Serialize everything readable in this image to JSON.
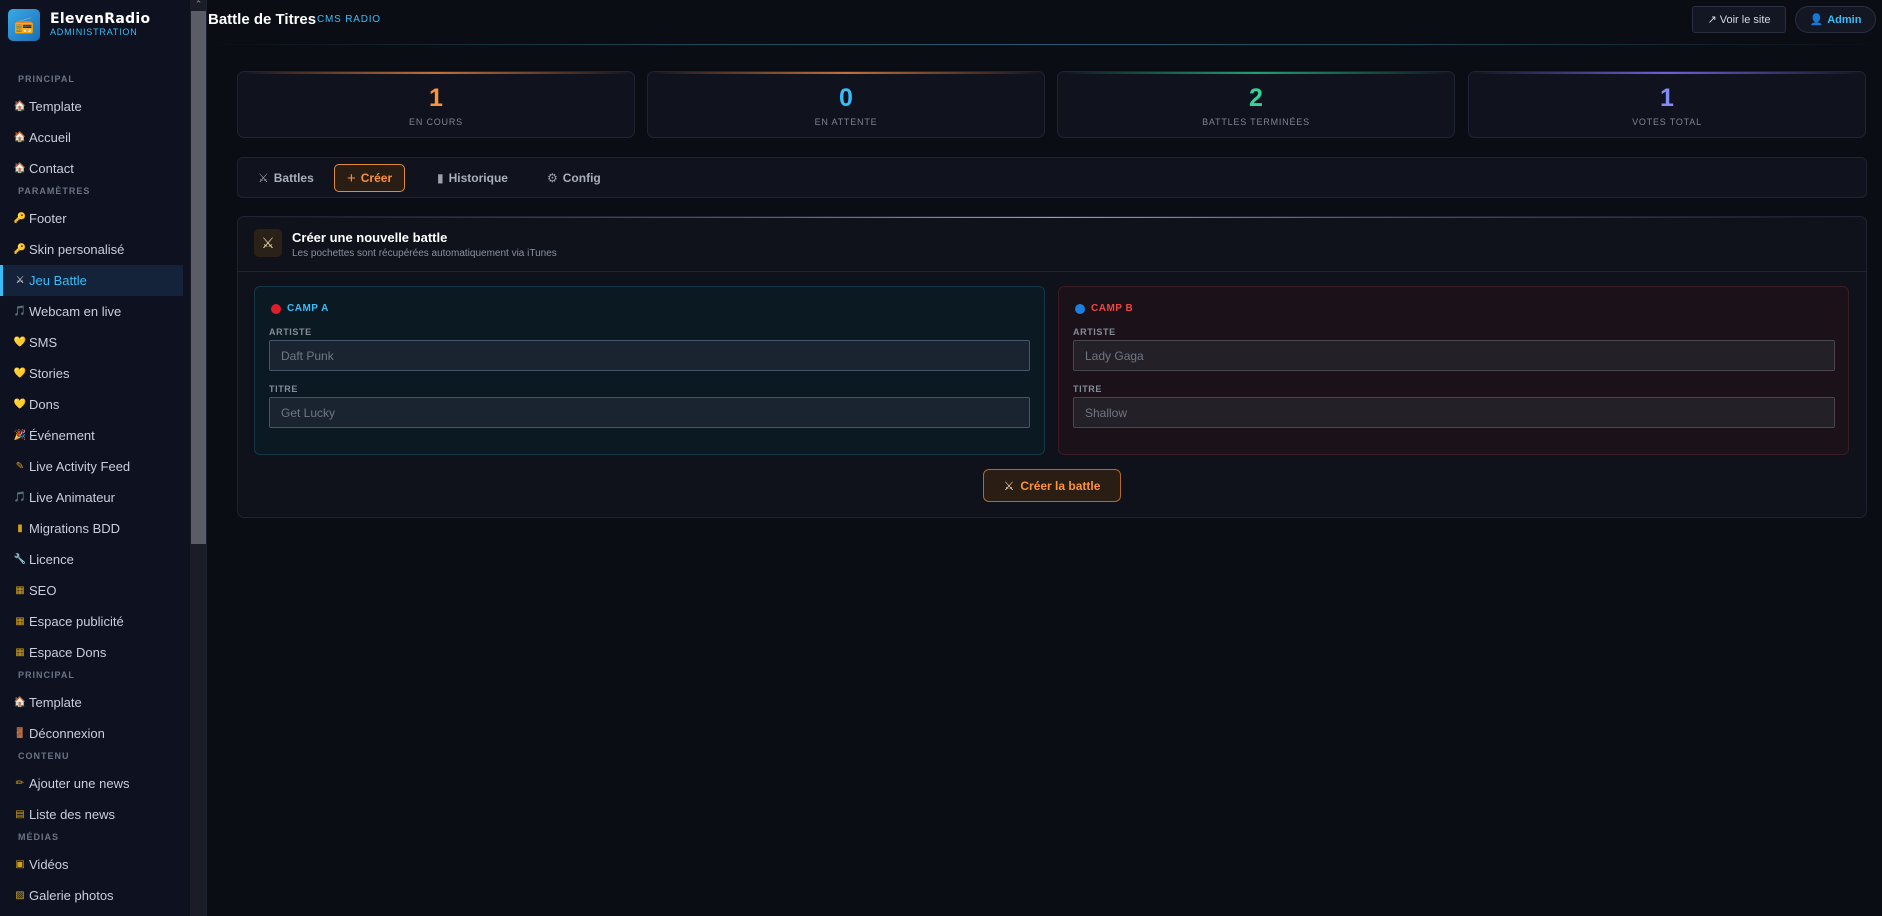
{
  "brand": {
    "logo_glyph": "📻",
    "name": "ElevenRadio",
    "subtitle": "ADMINISTRATION"
  },
  "sidebar": {
    "sections": [
      {
        "title": "PRINCIPAL",
        "items": [
          {
            "icon": "home-icon",
            "glyph": "🏠",
            "label": "Template"
          },
          {
            "icon": "home-icon",
            "glyph": "🏠",
            "label": "Accueil"
          },
          {
            "icon": "home-icon",
            "glyph": "🏠",
            "label": "Contact"
          }
        ]
      },
      {
        "title": "PARAMÈTRES",
        "items": [
          {
            "icon": "key-icon",
            "glyph": "🔑",
            "label": "Footer"
          },
          {
            "icon": "key-icon",
            "glyph": "🔑",
            "label": "Skin personalisé"
          },
          {
            "icon": "swords-icon",
            "glyph": "⚔",
            "label": "Jeu Battle",
            "active": true
          },
          {
            "icon": "music-icon",
            "glyph": "🎵",
            "label": "Webcam en live"
          },
          {
            "icon": "heart-icon",
            "glyph": "💛",
            "label": "SMS"
          },
          {
            "icon": "heart-icon",
            "glyph": "💛",
            "label": "Stories"
          },
          {
            "icon": "heart-icon",
            "glyph": "💛",
            "label": "Dons"
          },
          {
            "icon": "party-icon",
            "glyph": "🎉",
            "label": "Événement"
          },
          {
            "icon": "pen-icon",
            "glyph": "✎",
            "label": "Live Activity Feed"
          },
          {
            "icon": "music-icon",
            "glyph": "🎵",
            "label": "Live Animateur"
          },
          {
            "icon": "database-icon",
            "glyph": "▮",
            "label": "Migrations BDD"
          },
          {
            "icon": "wrench-icon",
            "glyph": "🔧",
            "label": "Licence"
          },
          {
            "icon": "chart-icon",
            "glyph": "▦",
            "label": "SEO"
          },
          {
            "icon": "chart-icon",
            "glyph": "▦",
            "label": "Espace publicité"
          },
          {
            "icon": "chart-icon",
            "glyph": "▦",
            "label": "Espace Dons"
          }
        ]
      },
      {
        "title": "PRINCIPAL",
        "items": [
          {
            "icon": "home-icon",
            "glyph": "🏠",
            "label": "Template"
          },
          {
            "icon": "door-icon",
            "glyph": "🚪",
            "label": "Déconnexion"
          }
        ]
      },
      {
        "title": "CONTENU",
        "items": [
          {
            "icon": "pencil-icon",
            "glyph": "✏",
            "label": "Ajouter une news"
          },
          {
            "icon": "list-icon",
            "glyph": "▤",
            "label": "Liste des news"
          }
        ]
      },
      {
        "title": "MÉDIAS",
        "items": [
          {
            "icon": "film-icon",
            "glyph": "▣",
            "label": "Vidéos"
          },
          {
            "icon": "image-icon",
            "glyph": "▨",
            "label": "Galerie photos"
          }
        ]
      }
    ]
  },
  "topbar": {
    "title": "Battle de Titres",
    "badge": "CMS RADIO",
    "view_site": "↗ Voir le site",
    "admin_label": "Admin",
    "admin_glyph": "👤"
  },
  "stats": [
    {
      "value": "1",
      "label": "EN COURS",
      "color": "#fb923c"
    },
    {
      "value": "0",
      "label": "EN ATTENTE",
      "color": "#38bdf8"
    },
    {
      "value": "2",
      "label": "BATTLES TERMINÉES",
      "color": "#34d399"
    },
    {
      "value": "1",
      "label": "VOTES TOTAL",
      "color": "#818cf8"
    }
  ],
  "tabs": [
    {
      "glyph": "⚔",
      "label": "Battles"
    },
    {
      "glyph": "+",
      "label": "Créer"
    },
    {
      "glyph": "▮",
      "label": "Historique"
    },
    {
      "glyph": "⚙",
      "label": "Config"
    }
  ],
  "create": {
    "icon_glyph": "⚔",
    "title": "Créer une nouvelle battle",
    "subtitle": "Les pochettes sont récupérées automatiquement via iTunes",
    "camp_a": {
      "label": "CAMP A",
      "color": "#38bdf8",
      "dot_color": "#e11d2a",
      "artist_label": "ARTISTE",
      "artist_placeholder": "Daft Punk",
      "title_label": "TITRE",
      "title_placeholder": "Get Lucky"
    },
    "camp_b": {
      "label": "CAMP B",
      "color": "#ef4444",
      "dot_color": "#1d7fe0",
      "artist_label": "ARTISTE",
      "artist_placeholder": "Lady Gaga",
      "title_label": "TITRE",
      "title_placeholder": "Shallow"
    },
    "submit_glyph": "⚔",
    "submit_label": "Créer la battle"
  },
  "colors": {
    "accent": "#38bdf8",
    "create_accent": "#fb923c",
    "background": "#0b0d14"
  }
}
